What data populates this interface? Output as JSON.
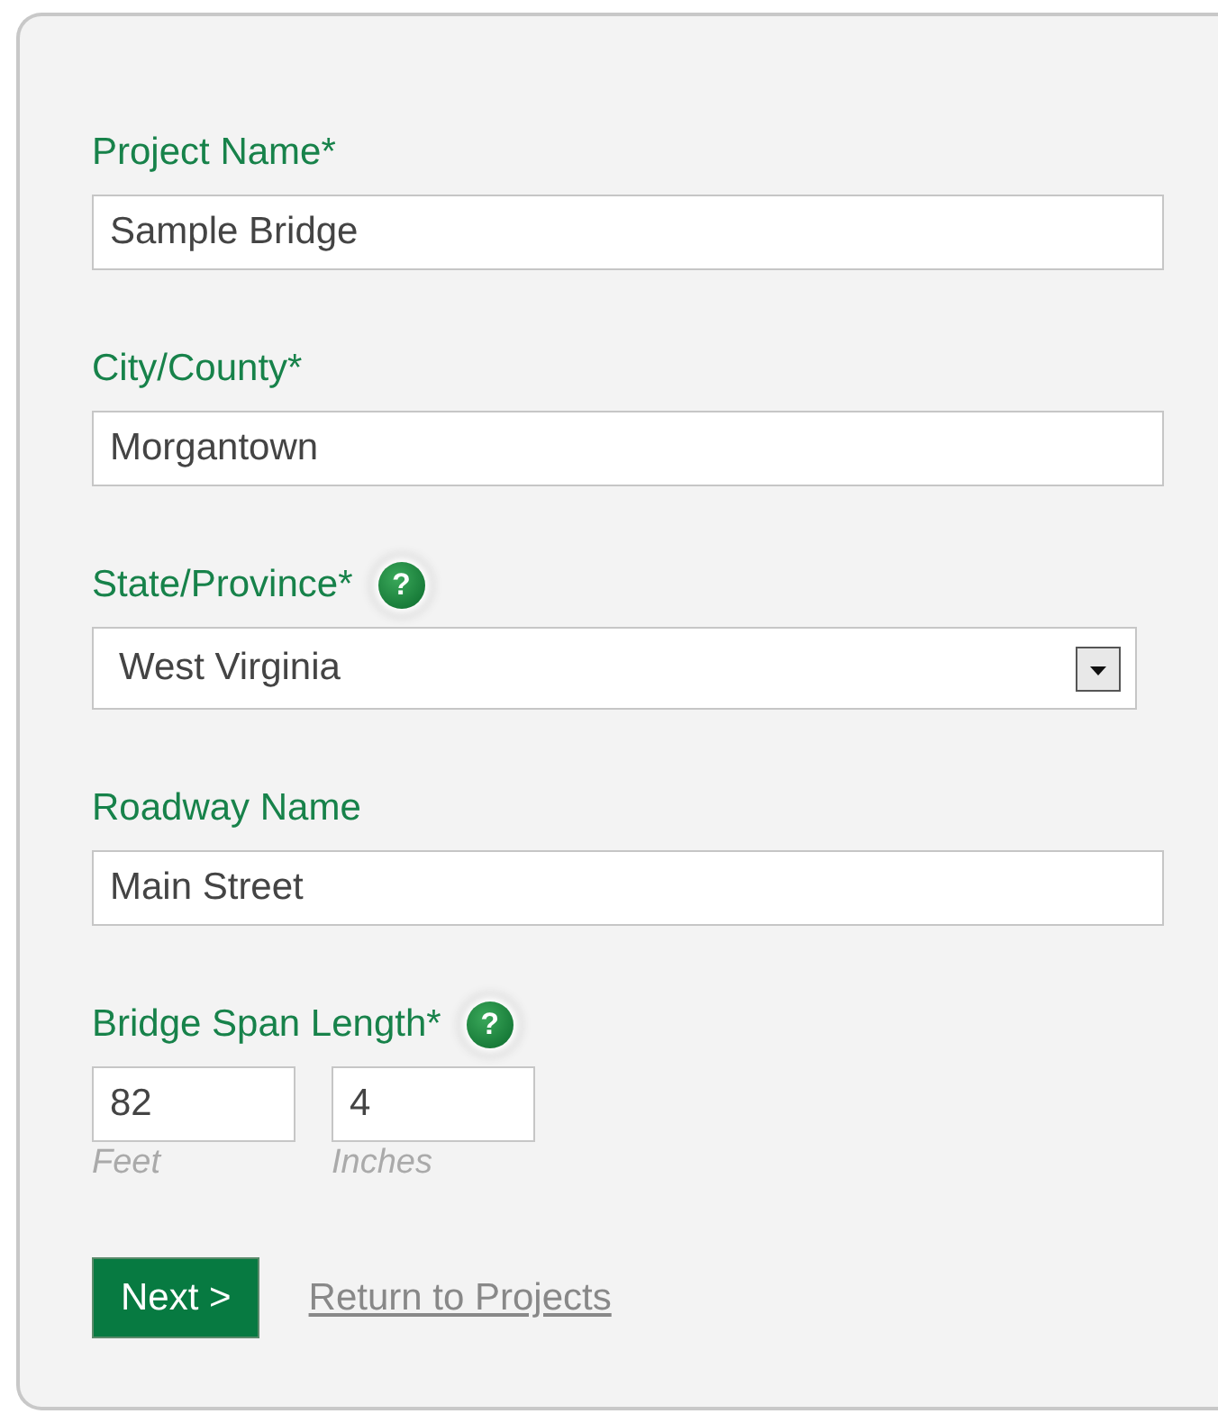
{
  "fields": [
    {
      "kind": "text",
      "label": "Project Name*",
      "value": "Sample Bridge"
    },
    {
      "kind": "text",
      "label": "City/County*",
      "value": "Morgantown"
    },
    {
      "kind": "select",
      "label": "State/Province*",
      "help": "?",
      "value": "West Virginia"
    },
    {
      "kind": "text",
      "label": "Roadway Name",
      "value": "Main Street"
    },
    {
      "kind": "dimension",
      "label": "Bridge Span Length*",
      "help": "?",
      "parts": [
        {
          "value": "82",
          "unit": "Feet"
        },
        {
          "value": "4",
          "unit": "Inches"
        }
      ]
    }
  ],
  "actions": {
    "next": "Next >",
    "back": "Return to Projects"
  }
}
